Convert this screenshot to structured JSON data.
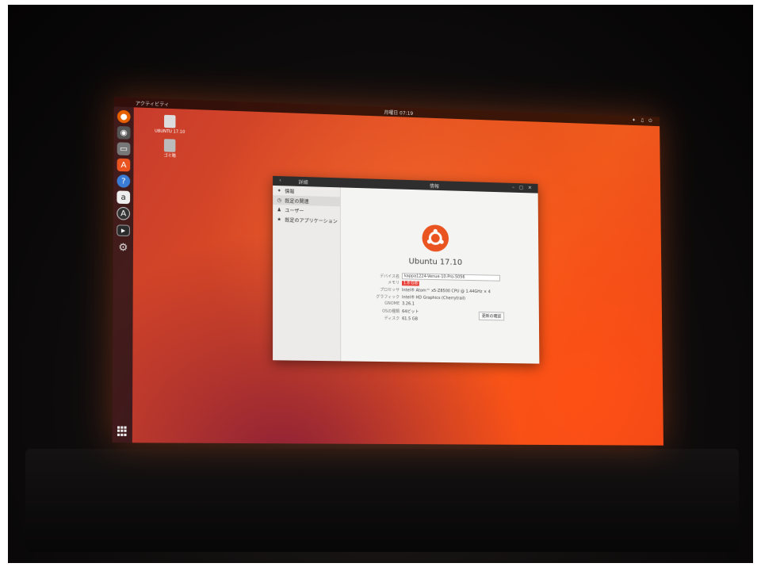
{
  "topbar": {
    "activities": "アクティビティ",
    "clock": "月曜日 07:19",
    "tray": "✦ ♫ ⏻"
  },
  "desktop": {
    "icons": [
      {
        "label": "UBUNTU 17.10",
        "icon": "drive-icon"
      },
      {
        "label": "ゴミ箱",
        "icon": "trash-icon"
      }
    ]
  },
  "dock": {
    "apps": [
      "firefox-icon",
      "chat-icon",
      "files-icon",
      "software-icon",
      "help-icon",
      "amazon-icon",
      "updater-icon",
      "terminal-icon",
      "settings-icon"
    ]
  },
  "window": {
    "header_left": "詳細",
    "header_right": "情報",
    "sidebar": [
      "情報",
      "既定の関連",
      "ユーザー",
      "既定のアプリケーション"
    ],
    "os_name": "Ubuntu 17.10",
    "details": [
      {
        "key": "デバイス名",
        "value": "kappa1224-Venue-10-Pro-5056"
      },
      {
        "key": "メモリ",
        "value": "1.8 GiB"
      },
      {
        "key": "プロセッサ",
        "value": "Intel® Atom™ x5-Z8500 CPU @ 1.44GHz × 4"
      },
      {
        "key": "グラフィック",
        "value": "Intel® HD Graphics (Cherrytrail)"
      },
      {
        "key": "GNOME",
        "value": "3.26.1"
      },
      {
        "key": "OSの種類",
        "value": "64ビット"
      },
      {
        "key": "ディスク",
        "value": "61.5 GB"
      }
    ],
    "update_button": "更新の確認"
  },
  "colors": {
    "accent": "#e95420",
    "wallpaper": "#e5521f"
  }
}
